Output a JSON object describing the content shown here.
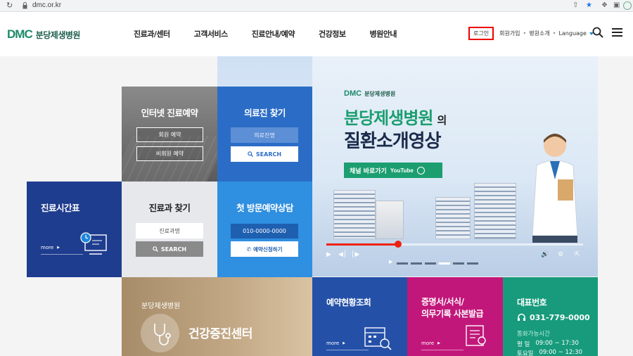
{
  "browser": {
    "url": "dmc.or.kr"
  },
  "header": {
    "logo_mark": "DMC",
    "logo_name": "분당제생병원",
    "nav": [
      "진료과/센터",
      "고객서비스",
      "진료안내/예약",
      "건강정보",
      "병원안내"
    ],
    "login": "로그인",
    "join": "회원가입",
    "intro": "병원소개",
    "language": "Language"
  },
  "tiles": {
    "online": {
      "title": "인터넷 진료예약",
      "member": "회원 예약",
      "nonmember": "비회원 예약"
    },
    "doctor": {
      "title": "의료진 찾기",
      "placeholder": "의료진명",
      "search": "SEARCH"
    },
    "schedule": {
      "title": "진료시간표",
      "more": "more"
    },
    "dept": {
      "title": "진료과 찾기",
      "placeholder": "진료과명",
      "search": "SEARCH"
    },
    "first_visit": {
      "title": "첫 방문예약상담",
      "phone": "010-0000-0000",
      "button": "예약신청하기"
    },
    "video": {
      "logo_mark": "DMC",
      "logo_name": "분당제생병원",
      "title_a": "분당제생병원",
      "title_a_suffix": "의",
      "title_b": "질환소개영상",
      "channel": "채널 바로가기",
      "channel_brand": "YouTube",
      "progress": 0.28,
      "slide_count": 6,
      "active_slide": 4
    },
    "health": {
      "sub": "분당제생병원",
      "title": "건강증진센터"
    },
    "reservation_check": {
      "title": "예약현황조회",
      "more": "more"
    },
    "certificate": {
      "title_line1": "증명서/서식/",
      "title_line2": "의무기록 사본발급",
      "more": "more"
    },
    "representative": {
      "title": "대표번호",
      "phone": "031-779-0000",
      "hours_title": "통화가능시간",
      "weekday_label": "평   일",
      "weekday_hours": "09:00 ~ 17:30",
      "saturday_label": "토요일",
      "saturday_hours": "09:00 ~ 12:30"
    }
  },
  "colors": {
    "brand_green": "#1c8a6a",
    "online_gray": "#6f6f6f",
    "doctor_blue": "#2b6dc6",
    "schedule_navy": "#1f3d8f",
    "first_visit_blue": "#2f8fe0",
    "reservation_blue": "#2450a8",
    "certificate_magenta": "#c2177a",
    "representative_teal": "#179b7c",
    "login_highlight": "#e00000"
  }
}
